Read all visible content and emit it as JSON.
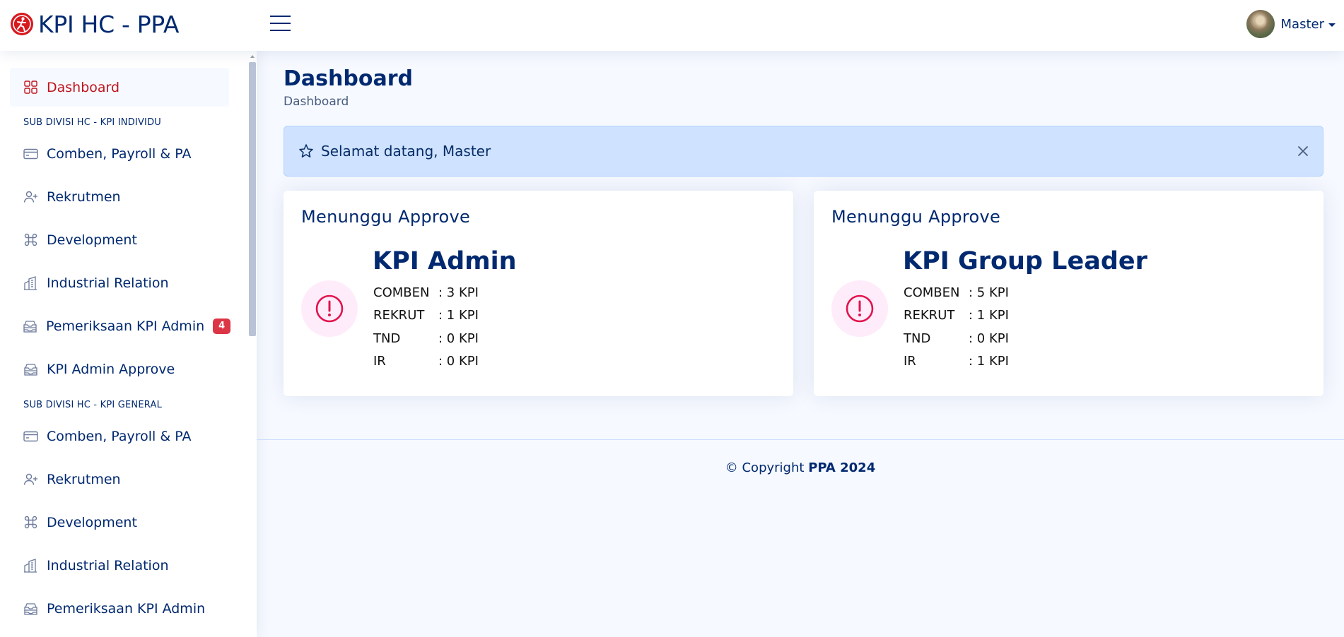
{
  "header": {
    "app_title": "KPI HC - PPA",
    "user_name": "Master"
  },
  "sidebar": {
    "items_top": [
      {
        "label": "Dashboard",
        "icon": "grid-icon"
      }
    ],
    "section1_title": "SUB DIVISI HC - KPI INDIVIDU",
    "section1_items": [
      {
        "label": "Comben, Payroll & PA",
        "icon": "credit-card-icon"
      },
      {
        "label": "Rekrutmen",
        "icon": "person-plus-icon"
      },
      {
        "label": "Development",
        "icon": "command-icon"
      },
      {
        "label": "Industrial Relation",
        "icon": "buildings-icon"
      },
      {
        "label": "Pemeriksaan KPI Admin",
        "icon": "inbox-stack-icon",
        "badge": "4"
      },
      {
        "label": "KPI Admin Approve",
        "icon": "inbox-stack-icon"
      }
    ],
    "section2_title": "SUB DIVISI HC - KPI GENERAL",
    "section2_items": [
      {
        "label": "Comben, Payroll & PA",
        "icon": "credit-card-icon"
      },
      {
        "label": "Rekrutmen",
        "icon": "person-plus-icon"
      },
      {
        "label": "Development",
        "icon": "command-icon"
      },
      {
        "label": "Industrial Relation",
        "icon": "buildings-icon"
      },
      {
        "label": "Pemeriksaan KPI Admin",
        "icon": "inbox-stack-icon"
      }
    ]
  },
  "main": {
    "page_title": "Dashboard",
    "breadcrumb": "Dashboard",
    "alert_text": "Selamat datang, Master",
    "cards": [
      {
        "title": "Menunggu Approve",
        "heading": "KPI Admin",
        "stats": [
          {
            "label": "COMBEN",
            "value": ": 3  KPI"
          },
          {
            "label": "REKRUT",
            "value": ": 1  KPI"
          },
          {
            "label": "TND",
            "value": ": 0  KPI"
          },
          {
            "label": "IR",
            "value": ": 0  KPI"
          }
        ]
      },
      {
        "title": "Menunggu Approve",
        "heading": "KPI Group Leader",
        "stats": [
          {
            "label": "COMBEN",
            "value": ": 5  KPI"
          },
          {
            "label": "REKRUT",
            "value": ": 1  KPI"
          },
          {
            "label": "TND",
            "value": ": 0  KPI"
          },
          {
            "label": "IR",
            "value": ": 1  KPI"
          }
        ]
      }
    ]
  },
  "footer": {
    "prefix": "© Copyright",
    "brand": "PPA 2024"
  },
  "colors": {
    "primary": "#012970",
    "active": "#c0141c",
    "badge": "#dc3545",
    "alert_bg": "#cfe2ff",
    "icon_accent": "#e0144c"
  }
}
